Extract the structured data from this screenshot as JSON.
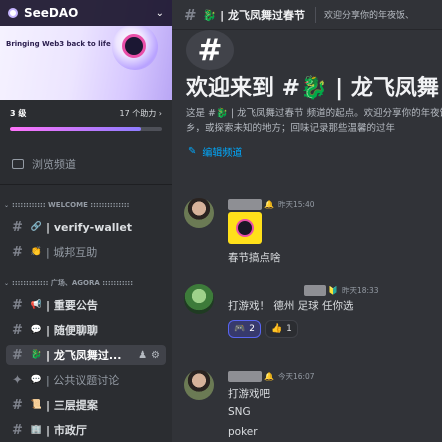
{
  "server": {
    "name": "SeeDAO",
    "tagline": "Bringing Web3 back to life",
    "boost": {
      "level": "3 级",
      "count": "17 个助力",
      "fraction": 0.86
    }
  },
  "sidebar": {
    "browse_label": "浏览频道",
    "categories": [
      {
        "label": "WELCOME",
        "raw": ":::::::::::: WELCOME ::::::::::::::"
      },
      {
        "label": "广场、AGORA",
        "raw": "::::::::::::: 广场、AGORA :::::::::::"
      }
    ],
    "channels": [
      {
        "emoji": "🔗",
        "name": "| verify-wallet",
        "unread": false,
        "muted": false
      },
      {
        "emoji": "👏",
        "name": "| 城邦互助",
        "unread": false,
        "muted": true
      },
      {
        "emoji": "📢",
        "name": "| 重要公告",
        "unread": true,
        "muted": false
      },
      {
        "emoji": "💬",
        "name": "| 随便聊聊",
        "unread": true,
        "muted": false
      },
      {
        "emoji": "🐉",
        "name": "| 龙飞凤舞过...",
        "unread": false,
        "muted": false,
        "active": true
      },
      {
        "emoji": "💬",
        "name": "| 公共议题讨论",
        "unread": false,
        "muted": true
      },
      {
        "emoji": "📜",
        "name": "| 三层提案",
        "unread": true,
        "muted": false
      },
      {
        "emoji": "🏢",
        "name": "| 市政厅",
        "unread": true,
        "muted": false
      }
    ]
  },
  "channel": {
    "name": "🐉 | 龙飞凤舞过春节",
    "topic": "欢迎分享你的年夜饭、",
    "welcome_title": "欢迎来到 #🐉 | 龙飞凤舞",
    "welcome_desc": "这是 #🐉 | 龙飞凤舞过春节 频道的起点。欢迎分享你的年夜饭、家乡，或探索未知的地方；回味记录那些温馨的过年",
    "edit_label": "编辑频道"
  },
  "messages": [
    {
      "time": "昨天15:40",
      "role_icon": "🔔",
      "has_sticker": true,
      "text": "春节搞点啥",
      "reactions": []
    },
    {
      "time": "昨天18:33",
      "role_icon": "🔰",
      "has_sticker": false,
      "text": "打游戏！ 德州 足球 任你选",
      "reactions": [
        {
          "emoji": "🎮",
          "count": "2",
          "on": true
        },
        {
          "emoji": "👍",
          "count": "1",
          "on": false
        }
      ]
    },
    {
      "time": "今天16:07",
      "role_icon": "🔔",
      "has_sticker": false,
      "lines": [
        "打游戏吧",
        "SNG",
        "poker"
      ],
      "reactions": []
    }
  ],
  "colors": {
    "accent": "#5865f2",
    "link": "#00a8fc",
    "boost_start": "#ff73fa",
    "boost_end": "#8e7dff"
  }
}
